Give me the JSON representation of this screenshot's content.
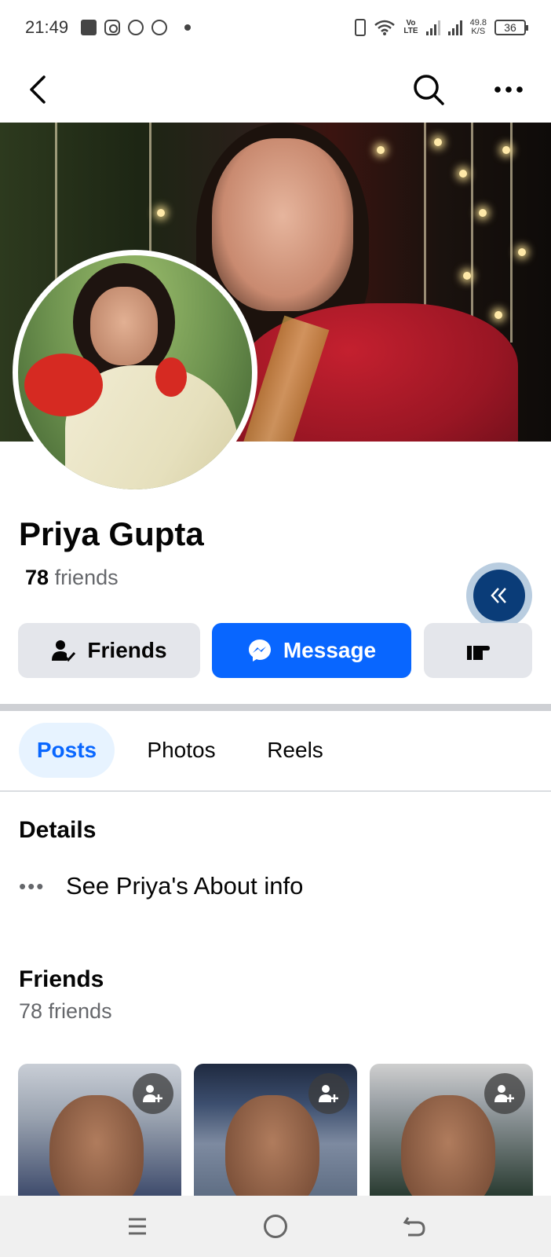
{
  "status_bar": {
    "time": "21:49",
    "icons": [
      "gallery-icon",
      "instagram-icon",
      "whatsapp-icon",
      "messenger-icon",
      "dot-icon"
    ],
    "right_icons": [
      "vibrate-icon",
      "wifi-icon",
      "volte-icon",
      "signal-icon",
      "signal-icon"
    ],
    "volte_label": "Vo\nLTE",
    "speed_value": "49.8",
    "speed_unit": "K/S",
    "battery": "36"
  },
  "top_nav": {
    "back_icon": "back-arrow-icon",
    "search_icon": "search-icon",
    "more_icon": "more-dots-icon"
  },
  "profile": {
    "name": "Priya Gupta",
    "friends_count": "78",
    "friends_word": "friends"
  },
  "actions": {
    "friends_label": "Friends",
    "message_label": "Message",
    "more_icon": "poke-hand-icon"
  },
  "tabs": [
    {
      "label": "Posts",
      "active": true
    },
    {
      "label": "Photos",
      "active": false
    },
    {
      "label": "Reels",
      "active": false
    }
  ],
  "details": {
    "title": "Details",
    "about_text": "See Priya's About info"
  },
  "friends_section": {
    "title": "Friends",
    "subtitle": "78 friends",
    "cards": [
      {
        "add_icon": "add-friend-icon"
      },
      {
        "add_icon": "add-friend-icon"
      },
      {
        "add_icon": "add-friend-icon"
      }
    ]
  },
  "colors": {
    "primary_blue": "#0866ff",
    "button_gray": "#e4e6eb",
    "secondary_text": "#65676b",
    "active_tab_bg": "#e7f3ff",
    "fab_navy": "#0a3c78"
  },
  "system_nav": {
    "icons": [
      "menu-lines-icon",
      "home-circle-icon",
      "back-return-icon"
    ]
  }
}
